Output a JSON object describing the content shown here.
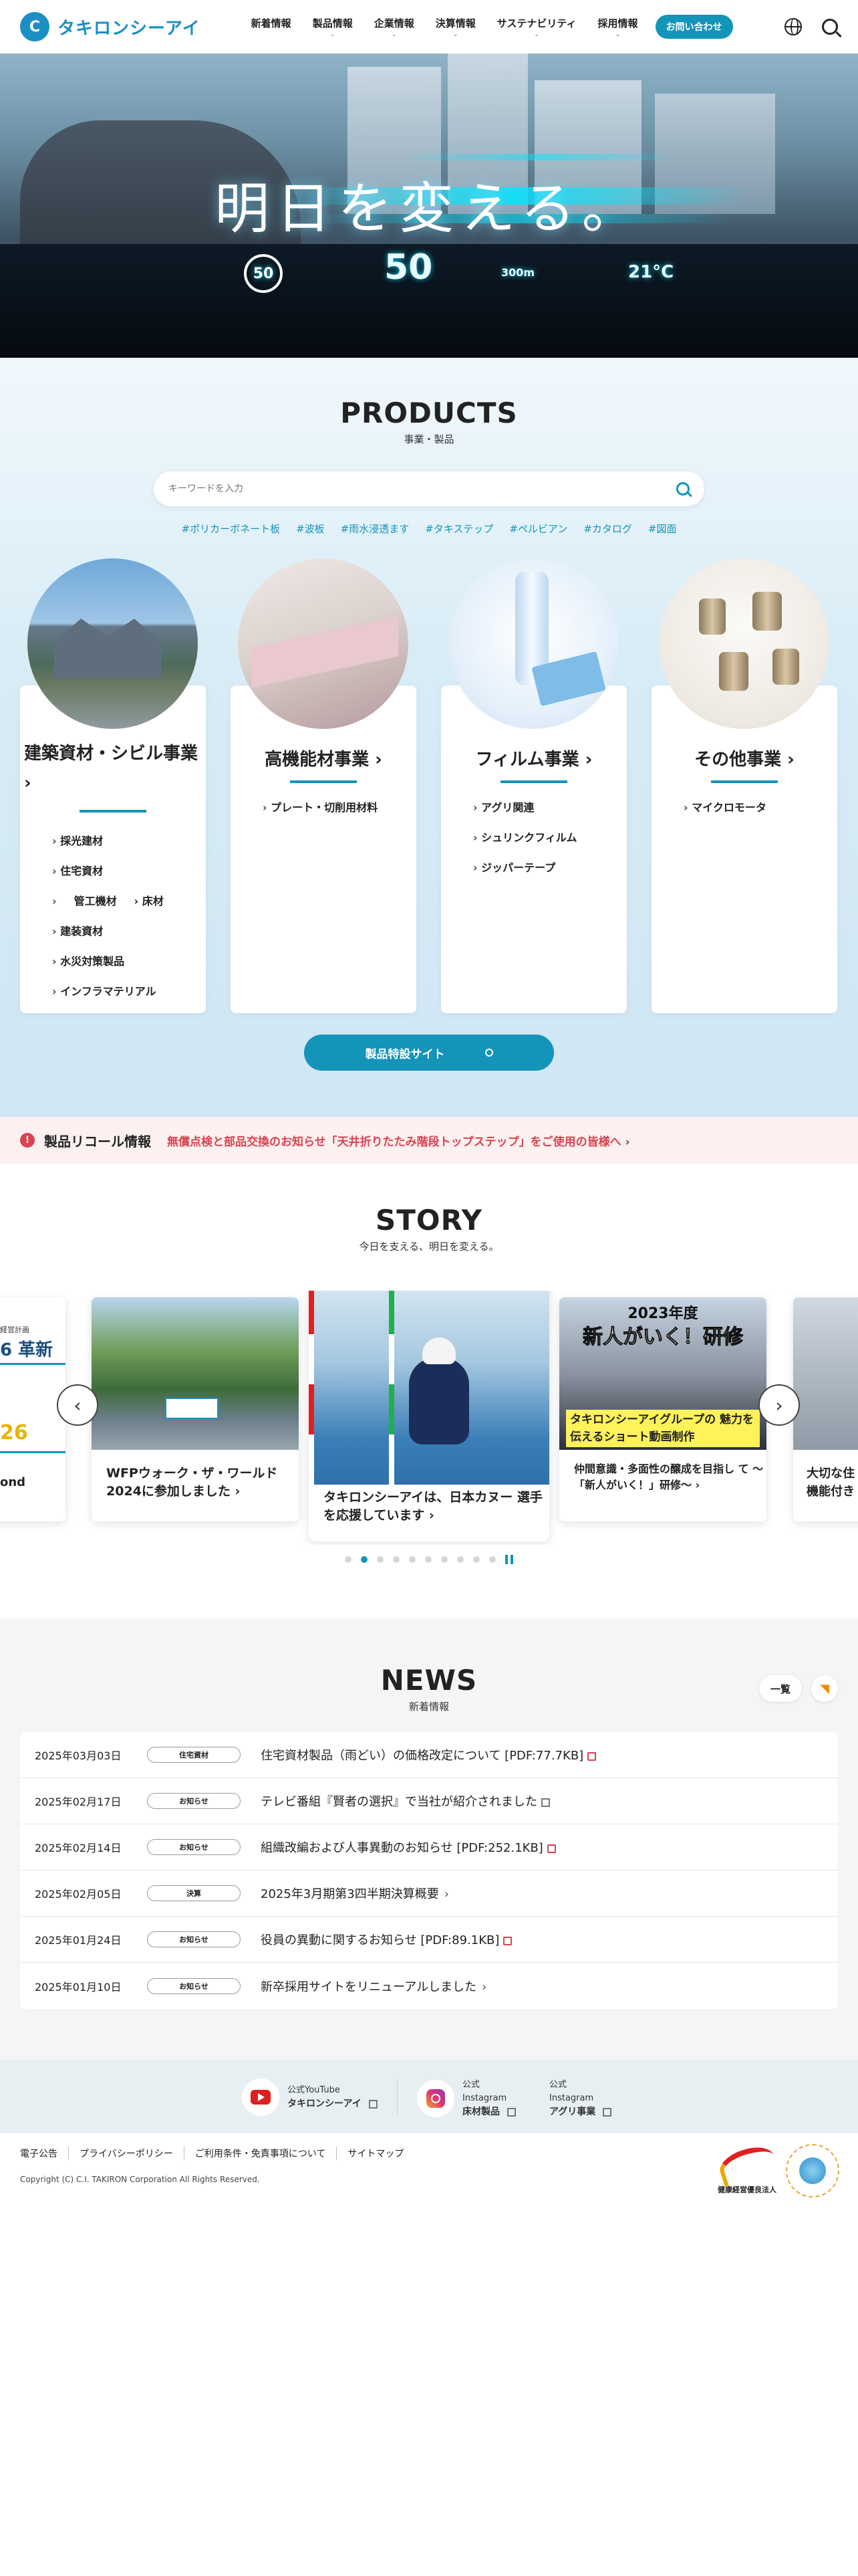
{
  "header": {
    "logo_text": "タキロンシーアイ",
    "nav": [
      {
        "label": "新着情報",
        "has_menu": false
      },
      {
        "label": "製品情報",
        "has_menu": true
      },
      {
        "label": "企業情報",
        "has_menu": true
      },
      {
        "label": "決算情報",
        "has_menu": true
      },
      {
        "label": "サステナビリティ",
        "has_menu": true
      },
      {
        "label": "採用情報",
        "has_menu": true
      }
    ],
    "contact_label": "お問い合わせ"
  },
  "hero": {
    "copy": "明日を変える。",
    "hud_speed": "50",
    "hud_limit": "50",
    "hud_temp": "21°C",
    "hud_distance": "300m"
  },
  "products": {
    "title": "PRODUCTS",
    "subtitle": "事業・製品",
    "search_placeholder": "キーワードを入力",
    "tags": [
      "#ポリカーボネート板",
      "#波板",
      "#雨水浸透ます",
      "#タキステップ",
      "#ペルビアン",
      "#カタログ",
      "#図面"
    ],
    "cards": [
      {
        "title": "建築資材・シビル事業",
        "items": [
          [
            "採光建材"
          ],
          [
            "住宅資材"
          ],
          [
            "管工機材",
            "床材"
          ],
          [
            "建装資材"
          ],
          [
            "水災対策製品"
          ],
          [
            "インフラマテリアル"
          ]
        ]
      },
      {
        "title": "高機能材事業",
        "items": [
          [
            "プレート・切削用材料"
          ]
        ]
      },
      {
        "title": "フィルム事業",
        "items": [
          [
            "アグリ関連"
          ],
          [
            "シュリンクフィルム"
          ],
          [
            "ジッパーテープ"
          ]
        ]
      },
      {
        "title": "その他事業",
        "items": [
          [
            "マイクロモータ"
          ]
        ]
      }
    ],
    "site_button": "製品特設サイト"
  },
  "recall": {
    "title": "製品リコール情報",
    "text": "無償点検と部品交換のお知らせ「天井折りたたみ階段トップステップ」をご使用の皆様へ"
  },
  "story": {
    "title": "STORY",
    "subtitle": "今日を支える、明日を変える。",
    "cards": [
      {
        "caption": "WFPウォーク・ザ・ワールド 2024に参加しました"
      },
      {
        "caption": "タキロンシーアイは、日本カヌー 選手を応援しています"
      },
      {
        "caption": "仲間意識・多面性の醸成を目指し て ～「新人がいく！」研修～",
        "overlay_year": "2023年度",
        "overlay_title": "新人がいく！研修",
        "overlay_band": "タキロンシーアイグループの 魅力を伝えるショート動画制作"
      }
    ],
    "partial_left": {
      "top_small": "経営計画",
      "big": "6 革新",
      "num": "26",
      "bottom": "ond"
    },
    "partial_right": {
      "caption": "大切な住 機能付き"
    },
    "dots": 10,
    "active_dot": 1
  },
  "news": {
    "title": "NEWS",
    "subtitle": "新着情報",
    "list_label": "一覧",
    "items": [
      {
        "date": "2025年03月03日",
        "category": "住宅資材",
        "title": "住宅資材製品（雨どい）の価格改定について [PDF:77.7KB]",
        "icon": "pdf"
      },
      {
        "date": "2025年02月17日",
        "category": "お知らせ",
        "title": "テレビ番組『賢者の選択』で当社が紹介されました",
        "icon": "ext"
      },
      {
        "date": "2025年02月14日",
        "category": "お知らせ",
        "title": "組織改編および人事異動のお知らせ [PDF:252.1KB]",
        "icon": "pdf"
      },
      {
        "date": "2025年02月05日",
        "category": "決算",
        "title": "2025年3月期第3四半期決算概要",
        "icon": "chev"
      },
      {
        "date": "2025年01月24日",
        "category": "お知らせ",
        "title": "役員の異動に関するお知らせ [PDF:89.1KB]",
        "icon": "pdf"
      },
      {
        "date": "2025年01月10日",
        "category": "お知らせ",
        "title": "新卒採用サイトをリニューアルしました",
        "icon": "chev"
      }
    ]
  },
  "social": [
    {
      "line1": "公式YouTube",
      "line2": "タキロンシーアイ"
    },
    {
      "line1": "公式",
      "line1b": "Instagram",
      "line2": "床材製品"
    },
    {
      "line1": "公式",
      "line1b": "Instagram",
      "line2": "アグリ事業"
    }
  ],
  "footer": {
    "links": [
      "電子公告",
      "プライバシーポリシー",
      "ご利用条件・免責事項について",
      "サイトマップ"
    ],
    "copyright": "Copyright (C) C.I. TAKIRON Corporation All Rights Reserved.",
    "badge_text": "健康経営優良法人"
  }
}
